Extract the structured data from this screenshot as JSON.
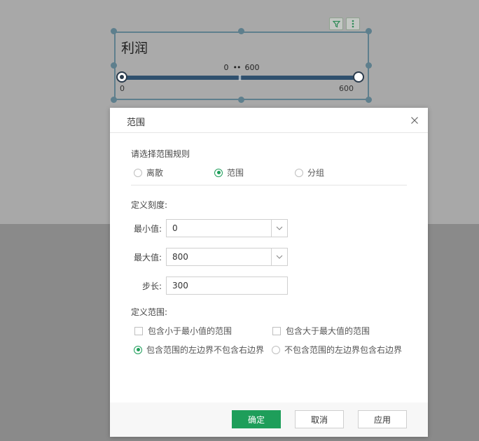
{
  "widget": {
    "title": "利润",
    "range_from": "0",
    "range_to": "600",
    "min_label": "0",
    "max_label": "600",
    "tools": {
      "filter_icon": "filter-icon",
      "more_icon": "more-vertical-icon"
    }
  },
  "dialog": {
    "title": "范围",
    "rule_label": "请选择范围规则",
    "rule_options": [
      {
        "label": "离散",
        "selected": false
      },
      {
        "label": "范围",
        "selected": true
      },
      {
        "label": "分组",
        "selected": false
      }
    ],
    "scale_label": "定义刻度:",
    "min_label": "最小值:",
    "min_value": "0",
    "max_label": "最大值:",
    "max_value": "800",
    "step_label": "步长:",
    "step_value": "300",
    "range_label": "定义范围:",
    "include_below_min": "包含小于最小值的范围",
    "include_above_max": "包含大于最大值的范围",
    "boundary_options": [
      {
        "label": "包含范围的左边界不包含右边界",
        "selected": true
      },
      {
        "label": "不包含范围的左边界包含右边界",
        "selected": false
      }
    ],
    "ok": "确定",
    "cancel": "取消",
    "apply": "应用"
  },
  "colors": {
    "accent": "#1e9e5a",
    "track": "#2f506e",
    "selection_border": "#5e7f8d"
  }
}
